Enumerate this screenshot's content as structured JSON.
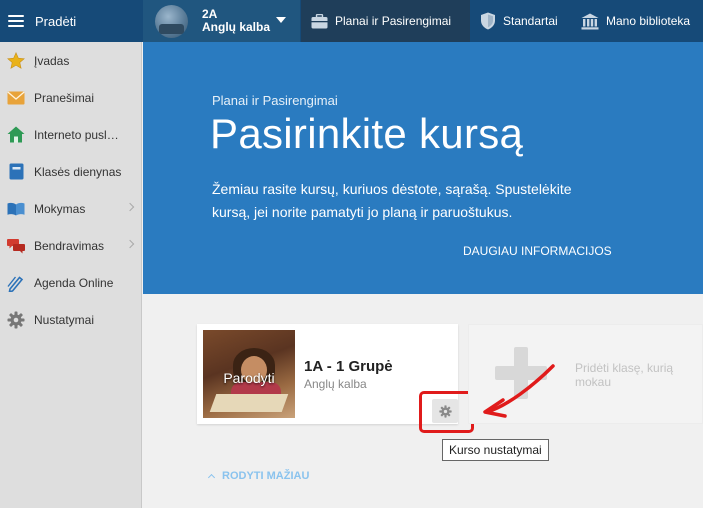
{
  "topbar": {
    "menu_label": "Pradėti",
    "class_name": "2A",
    "class_subject": "Anglų kalba",
    "nav": [
      {
        "label": "Planai ir Pasirengimai",
        "icon": "briefcase-icon",
        "active": true
      },
      {
        "label": "Standartai",
        "icon": "shield-icon",
        "active": false
      },
      {
        "label": "Mano biblioteka",
        "icon": "library-icon",
        "active": false
      }
    ]
  },
  "sidebar": {
    "items": [
      {
        "label": "Įvadas",
        "icon": "star-icon"
      },
      {
        "label": "Pranešimai",
        "icon": "envelope-icon"
      },
      {
        "label": "Interneto pusl…",
        "icon": "home-icon"
      },
      {
        "label": "Klasės dienynas",
        "icon": "book-icon"
      },
      {
        "label": "Mokymas",
        "icon": "open-book-icon",
        "has_submenu": true
      },
      {
        "label": "Bendravimas",
        "icon": "chat-icon",
        "has_submenu": true
      },
      {
        "label": "Agenda Online",
        "icon": "pencil-icon"
      },
      {
        "label": "Nustatymai",
        "icon": "gear-icon"
      }
    ]
  },
  "hero": {
    "kicker": "Planai ir Pasirengimai",
    "title": "Pasirinkite kursą",
    "description": "Žemiau rasite kursų, kuriuos dėstote, sąrašą. Spustelėkite kursą, jei norite pamatyti jo planą ir paruoštukus.",
    "more_link": "DAUGIAU INFORMACIJOS"
  },
  "course": {
    "thumb_label": "Parodyti",
    "name": "1A - 1 Grupė",
    "subject": "Anglų kalba",
    "settings_tooltip": "Kurso nustatymai"
  },
  "add_class": {
    "label": "Pridėti klasę, kurią mokau"
  },
  "show_less": "RODYTI MAŽIAU",
  "colors": {
    "topbar": "#164a78",
    "hero": "#2a7bc0",
    "annotation": "#e01b1b"
  }
}
